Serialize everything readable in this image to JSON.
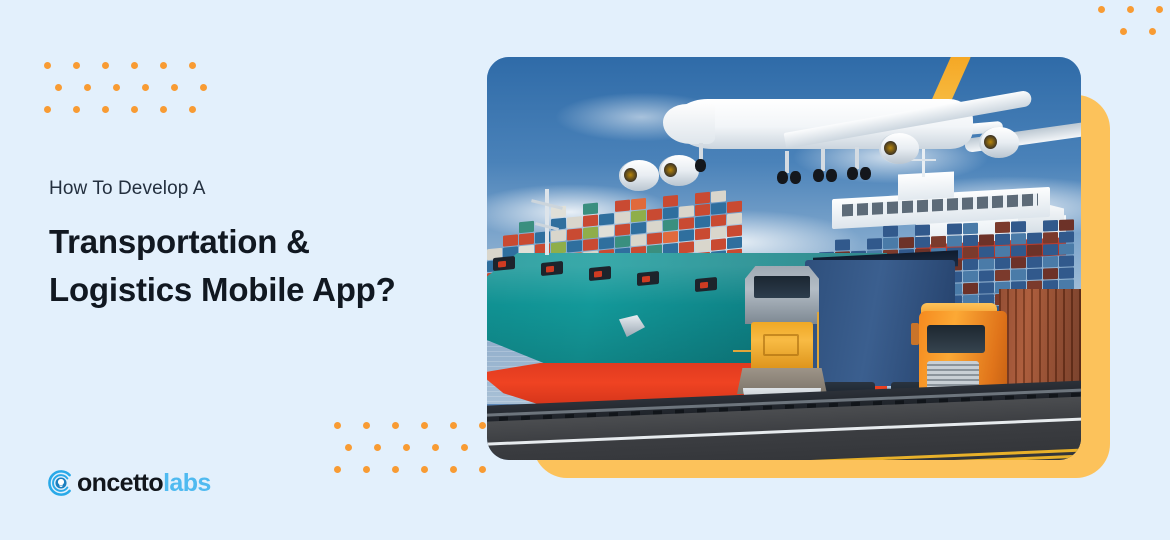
{
  "banner": {
    "background_color": "#e3f0fc",
    "accent_color": "#fcc25b",
    "dot_color": "#f89b33"
  },
  "text": {
    "eyebrow": "How To Develop A",
    "headline_line1": "Transportation &",
    "headline_line2": "Logistics Mobile App?"
  },
  "logo": {
    "mark_name": "concetto-labs-bulb-mark",
    "name_dark": "oncetto",
    "name_blue": "labs",
    "dark_color": "#12161c",
    "blue_color": "#4fbaf0"
  },
  "photo": {
    "alt": "Transportation and logistics collage: cargo airplane landing above a container ship, freight locomotive and orange semi truck on a road",
    "subjects": [
      "cargo-airplane",
      "container-ship",
      "freight-locomotive",
      "semi-truck",
      "shipping-containers",
      "road",
      "railway-track"
    ]
  },
  "decor": {
    "dots_top_left": {
      "rows": 3,
      "cols": 6
    },
    "dots_bottom_left": {
      "rows": 3,
      "cols": 6
    },
    "dots_top_right": {
      "rows": 2,
      "cols": 4
    }
  },
  "container_colors_ship": [
    [
      "#c94a32",
      "#2f6f9e",
      "#d9d6cc",
      "#3a8f7f",
      "#c94a32",
      "#1f5b86"
    ],
    [
      "#e06a3c",
      "#d9d6cc",
      "#2f6f9e",
      "#c94a32",
      "#8fae4a",
      "#d9d6cc"
    ],
    [
      "#2f6f9e",
      "#c94a32",
      "#e0e0d8",
      "#c94a32",
      "#3a8f7f",
      "#2f6f9e"
    ],
    [
      "#d9d6cc",
      "#3a8f7f",
      "#c94a32",
      "#2f6f9e",
      "#e06a3c",
      "#c94a32"
    ],
    [
      "#c94a32",
      "#2f6f9e",
      "#8fae4a",
      "#d9d6cc",
      "#2f6f9e",
      "#e0e0d8"
    ],
    [
      "#3a8f7f",
      "#e06a3c",
      "#2f6f9e",
      "#c94a32",
      "#d9d6cc",
      "#2f6f9e"
    ],
    [
      "#2f6f9e",
      "#d9d6cc",
      "#c94a32",
      "#8fae4a",
      "#c94a32",
      "#3a8f7f"
    ],
    [
      "#c94a32",
      "#c94a32",
      "#2f6f9e",
      "#e0e0d8",
      "#2f6f9e",
      "#d9d6cc"
    ],
    [
      "#e0e0d8",
      "#2f6f9e",
      "#3a8f7f",
      "#c94a32",
      "#d9d6cc",
      "#c94a32"
    ],
    [
      "#2f6f9e",
      "#c94a32",
      "#d9d6cc",
      "#2f6f9e",
      "#8fae4a",
      "#e06a3c"
    ],
    [
      "#c94a32",
      "#3a8f7f",
      "#c94a32",
      "#d9d6cc",
      "#c94a32",
      "#2f6f9e"
    ],
    [
      "#d9d6cc",
      "#2f6f9e",
      "#e06a3c",
      "#3a8f7f",
      "#2f6f9e",
      "#c94a32"
    ],
    [
      "#3a8f7f",
      "#c94a32",
      "#2f6f9e",
      "#c94a32",
      "#d9d6cc",
      "#2f6f9e"
    ],
    [
      "#c94a32",
      "#d9d6cc",
      "#c94a32",
      "#2f6f9e",
      "#c94a32",
      "#c94a32"
    ],
    [
      "#2f6f9e",
      "#c94a32",
      "#d9d6cc",
      "#c94a32",
      "#2f6f9e",
      "#d9d6cc"
    ],
    [
      "#c94a32",
      "#2f6f9e",
      "#c94a32",
      "#d9d6cc",
      "#c94a32",
      "#c94a32"
    ]
  ],
  "container_colors_bg": [
    [
      "#31598c",
      "#7b3a2c",
      "#2d5c8a",
      "#4a7ba8",
      "#31598c",
      "#6d3228"
    ],
    [
      "#4a7ba8",
      "#31598c",
      "#7b3a2c",
      "#31598c",
      "#4a7ba8",
      "#2d5c8a"
    ],
    [
      "#7b3a2c",
      "#4a7ba8",
      "#31598c",
      "#6d3228",
      "#31598c",
      "#4a7ba8"
    ],
    [
      "#31598c",
      "#7b3a2c",
      "#4a7ba8",
      "#31598c",
      "#7b3a2c",
      "#31598c"
    ],
    [
      "#2d5c8a",
      "#31598c",
      "#6d3228",
      "#4a7ba8",
      "#31598c",
      "#7b3a2c"
    ],
    [
      "#4a7ba8",
      "#6d3228",
      "#31598c",
      "#7b3a2c",
      "#4a7ba8",
      "#31598c"
    ],
    [
      "#31598c",
      "#4a7ba8",
      "#7b3a2c",
      "#31598c",
      "#6d3228",
      "#4a7ba8"
    ],
    [
      "#7b3a2c",
      "#31598c",
      "#4a7ba8",
      "#6d3228",
      "#31598c",
      "#31598c"
    ],
    [
      "#31598c",
      "#7b3a2c",
      "#31598c",
      "#4a7ba8",
      "#7b3a2c",
      "#2d5c8a"
    ],
    [
      "#4a7ba8",
      "#31598c",
      "#6d3228",
      "#31598c",
      "#4a7ba8",
      "#31598c"
    ],
    [
      "#6d3228",
      "#4a7ba8",
      "#31598c",
      "#7b3a2c",
      "#31598c",
      "#4a7ba8"
    ],
    [
      "#31598c",
      "#31598c",
      "#4a7ba8",
      "#31598c",
      "#6d3228",
      "#31598c"
    ],
    [
      "#4a7ba8",
      "#7b3a2c",
      "#31598c",
      "#4a7ba8",
      "#31598c",
      "#7b3a2c"
    ],
    [
      "#31598c",
      "#4a7ba8",
      "#6d3228",
      "#31598c",
      "#4a7ba8",
      "#31598c"
    ],
    [
      "#7b3a2c",
      "#31598c",
      "#31598c",
      "#6d3228",
      "#31598c",
      "#4a7ba8"
    ],
    [
      "#31598c",
      "#6d3228",
      "#4a7ba8",
      "#31598c",
      "#7b3a2c",
      "#31598c"
    ],
    [
      "#4a7ba8",
      "#31598c",
      "#31598c",
      "#4a7ba8",
      "#31598c",
      "#6d3228"
    ]
  ]
}
